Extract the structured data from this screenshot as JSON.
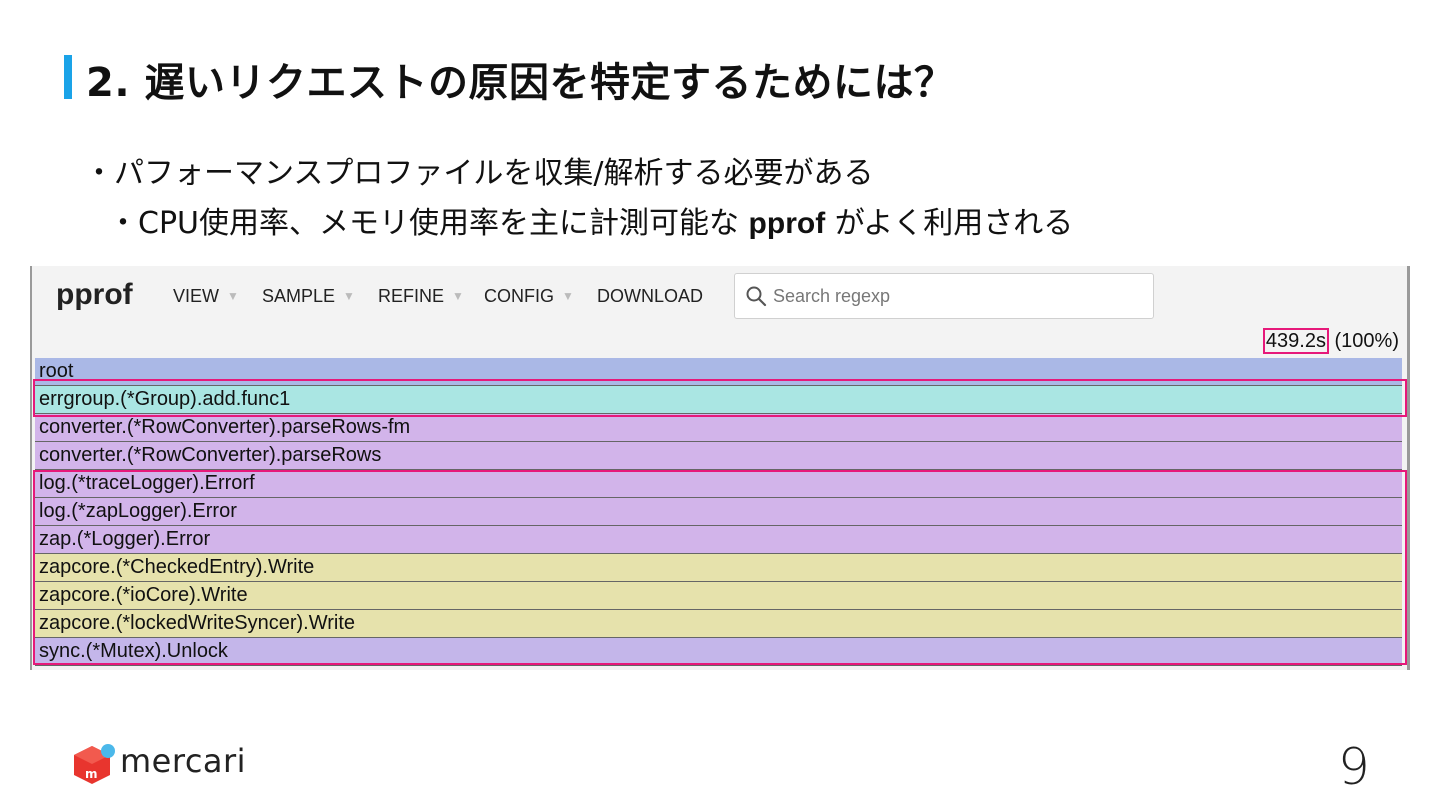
{
  "slide": {
    "title": "2. 遅いリクエストの原因を特定するためには？",
    "bullet1": "・パフォーマンスプロファイルを収集/解析する必要がある",
    "bullet2_prefix": "・CPU使用率、メモリ使用率を主に計測可能な ",
    "bullet2_bold": "pprof",
    "bullet2_suffix": " がよく利用される",
    "page_number": "9",
    "brand": "mercari",
    "accent_color": "#1aa3e8"
  },
  "pprof": {
    "logo": "pprof",
    "menu": [
      {
        "label": "VIEW",
        "has_dropdown": true
      },
      {
        "label": "SAMPLE",
        "has_dropdown": true
      },
      {
        "label": "REFINE",
        "has_dropdown": true
      },
      {
        "label": "CONFIG",
        "has_dropdown": true
      },
      {
        "label": "DOWNLOAD",
        "has_dropdown": false
      }
    ],
    "search": {
      "placeholder": "Search regexp",
      "value": "",
      "icon": "search-icon"
    },
    "total_time": "439.2s",
    "total_pct": "(100%)",
    "highlight_color": "#e6197a",
    "frames": [
      {
        "label": "root",
        "color": "#aab8e6"
      },
      {
        "label": "errgroup.(*Group).add.func1",
        "color": "#aae6e3"
      },
      {
        "label": "converter.(*RowConverter).parseRows-fm",
        "color": "#d2b4ea"
      },
      {
        "label": "converter.(*RowConverter).parseRows",
        "color": "#d2b4ea"
      },
      {
        "label": "log.(*traceLogger).Errorf",
        "color": "#d2b4ea"
      },
      {
        "label": "log.(*zapLogger).Error",
        "color": "#d2b4ea"
      },
      {
        "label": "zap.(*Logger).Error",
        "color": "#d2b4ea"
      },
      {
        "label": "zapcore.(*CheckedEntry).Write",
        "color": "#e6e2ac"
      },
      {
        "label": "zapcore.(*ioCore).Write",
        "color": "#e6e2ac"
      },
      {
        "label": "zapcore.(*lockedWriteSyncer).Write",
        "color": "#e6e2ac"
      },
      {
        "label": "sync.(*Mutex).Unlock",
        "color": "#c4b6ea"
      }
    ]
  }
}
